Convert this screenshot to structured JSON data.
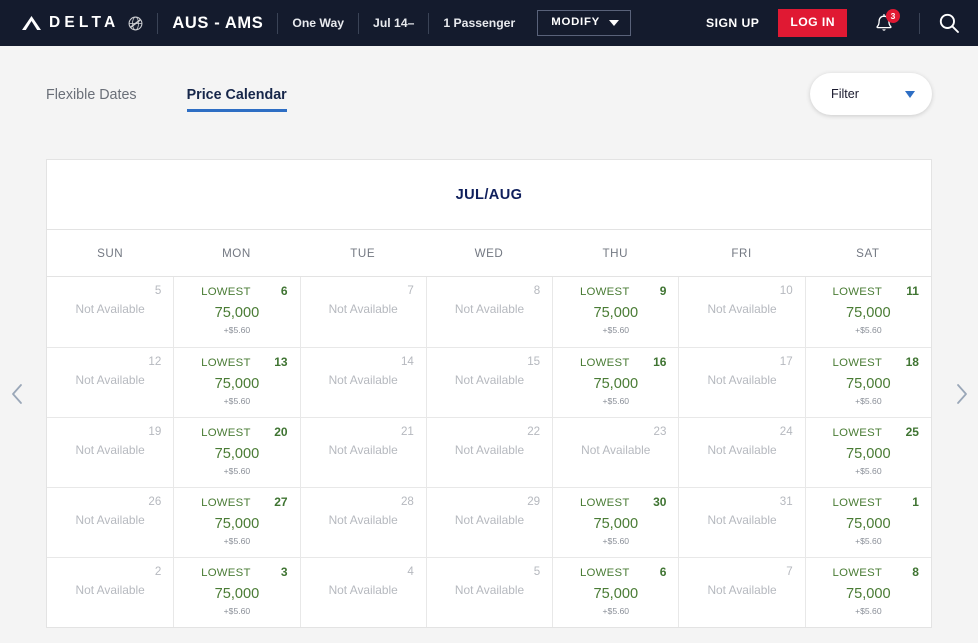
{
  "header": {
    "brand": "DELTA",
    "brand_icon": "delta-widget-icon",
    "skymiles_icon": "skymiles-globe-icon",
    "route": "AUS - AMS",
    "trip_type": "One Way",
    "dates": "Jul 14–",
    "passengers": "1 Passenger",
    "modify_label": "MODIFY",
    "modify_caret_icon": "chevron-down-icon",
    "sign_up": "SIGN UP",
    "log_in": "LOG IN",
    "bell_icon": "notification-bell-icon",
    "notification_count": "3",
    "search_icon": "search-icon",
    "login_color": "#e01933",
    "bar_color": "#141b2d"
  },
  "tabs": [
    {
      "label": "Flexible Dates",
      "active": false
    },
    {
      "label": "Price Calendar",
      "active": true
    }
  ],
  "filter": {
    "label": "Filter",
    "caret_icon": "chevron-down-icon",
    "accent_color": "#2e6ec4"
  },
  "calendar": {
    "title": "JUL/AUG",
    "prev_icon": "chevron-left-icon",
    "next_icon": "chevron-right-icon",
    "day_headers": [
      "SUN",
      "MON",
      "TUE",
      "WED",
      "THU",
      "FRI",
      "SAT"
    ],
    "lowest_label": "LOWEST",
    "price": "75,000",
    "taxes": "+$5.60",
    "not_available": "Not Available",
    "available_color": "#4a7c35",
    "unavailable_color": "#b6b9bf",
    "weeks": [
      [
        {
          "day": "5",
          "available": false
        },
        {
          "day": "6",
          "available": true
        },
        {
          "day": "7",
          "available": false
        },
        {
          "day": "8",
          "available": false
        },
        {
          "day": "9",
          "available": true
        },
        {
          "day": "10",
          "available": false
        },
        {
          "day": "11",
          "available": true
        }
      ],
      [
        {
          "day": "12",
          "available": false
        },
        {
          "day": "13",
          "available": true
        },
        {
          "day": "14",
          "available": false
        },
        {
          "day": "15",
          "available": false
        },
        {
          "day": "16",
          "available": true
        },
        {
          "day": "17",
          "available": false
        },
        {
          "day": "18",
          "available": true
        }
      ],
      [
        {
          "day": "19",
          "available": false
        },
        {
          "day": "20",
          "available": true
        },
        {
          "day": "21",
          "available": false
        },
        {
          "day": "22",
          "available": false
        },
        {
          "day": "23",
          "available": false
        },
        {
          "day": "24",
          "available": false
        },
        {
          "day": "25",
          "available": true
        }
      ],
      [
        {
          "day": "26",
          "available": false
        },
        {
          "day": "27",
          "available": true
        },
        {
          "day": "28",
          "available": false
        },
        {
          "day": "29",
          "available": false
        },
        {
          "day": "30",
          "available": true
        },
        {
          "day": "31",
          "available": false
        },
        {
          "day": "1",
          "available": true
        }
      ],
      [
        {
          "day": "2",
          "available": false
        },
        {
          "day": "3",
          "available": true
        },
        {
          "day": "4",
          "available": false
        },
        {
          "day": "5",
          "available": false
        },
        {
          "day": "6",
          "available": true
        },
        {
          "day": "7",
          "available": false
        },
        {
          "day": "8",
          "available": true
        }
      ]
    ]
  }
}
